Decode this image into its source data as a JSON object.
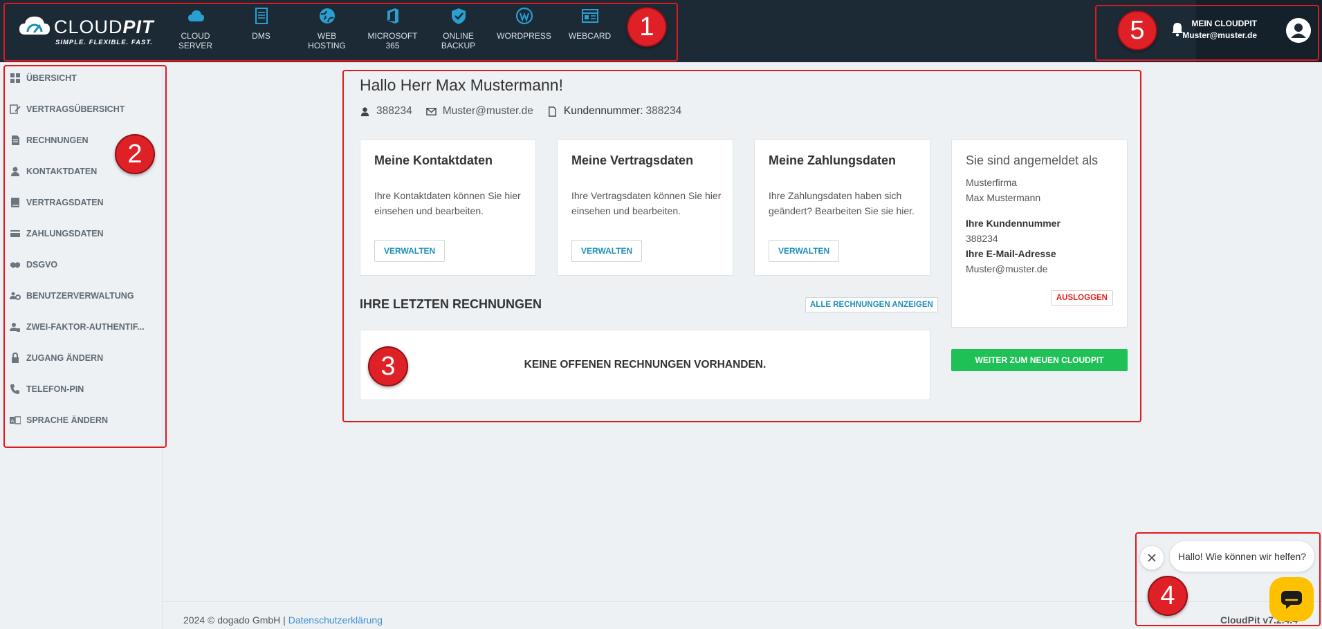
{
  "header": {
    "logo": {
      "brand_thin": "CLOUD",
      "brand_bold": "PIT",
      "tagline": "SIMPLE. FLEXIBLE. FAST."
    },
    "nav": [
      {
        "label": "CLOUD\nSERVER",
        "icon": "cloud-icon"
      },
      {
        "label": "DMS",
        "icon": "document-icon"
      },
      {
        "label": "WEB\nHOSTING",
        "icon": "globe-icon"
      },
      {
        "label": "MICROSOFT 365",
        "icon": "office-icon"
      },
      {
        "label": "ONLINE\nBACKUP",
        "icon": "shield-icon"
      },
      {
        "label": "WORDPRESS",
        "icon": "wordpress-icon"
      },
      {
        "label": "WEBCARD",
        "icon": "webcard-icon"
      }
    ],
    "account": {
      "title": "MEIN CLOUDPIT",
      "email": "Muster@muster.de"
    }
  },
  "markers": [
    "1",
    "2",
    "3",
    "4",
    "5"
  ],
  "sidebar": {
    "items": [
      {
        "label": "ÜBERSICHT",
        "icon": "grid-icon"
      },
      {
        "label": "VERTRAGSÜBERSICHT",
        "icon": "contract-edit-icon"
      },
      {
        "label": "RECHNUNGEN",
        "icon": "invoice-icon"
      },
      {
        "label": "KONTAKTDATEN",
        "icon": "user-icon"
      },
      {
        "label": "VERTRAGSDATEN",
        "icon": "book-icon"
      },
      {
        "label": "ZAHLUNGSDATEN",
        "icon": "credit-card-icon"
      },
      {
        "label": "DSGVO",
        "icon": "handshake-icon"
      },
      {
        "label": "BENUTZERVERWALTUNG",
        "icon": "users-cog-icon"
      },
      {
        "label": "ZWEI-FAKTOR-AUTHENTIF...",
        "icon": "user-lock-icon"
      },
      {
        "label": "ZUGANG ÄNDERN",
        "icon": "lock-icon"
      },
      {
        "label": "TELEFON-PIN",
        "icon": "phone-icon"
      },
      {
        "label": "SPRACHE ÄNDERN",
        "icon": "language-icon"
      }
    ]
  },
  "main": {
    "greeting": "Hallo Herr Max Mustermann!",
    "meta": {
      "user_id": "388234",
      "email": "Muster@muster.de",
      "customer_label": "Kundennummer:",
      "customer_number": "388234"
    },
    "cards": [
      {
        "title": "Meine Kontaktdaten",
        "text": "Ihre Kontaktdaten können Sie hier einsehen und bearbeiten.",
        "button": "VERWALTEN"
      },
      {
        "title": "Meine Vertragsdaten",
        "text": "Ihre Vertragsdaten können Sie hier einsehen und bearbeiten.",
        "button": "VERWALTEN"
      },
      {
        "title": "Meine Zahlungsdaten",
        "text": "Ihre Zahlungsdaten haben sich geändert? Bearbeiten Sie sie hier.",
        "button": "VERWALTEN"
      }
    ],
    "login": {
      "title": "Sie sind angemeldet als",
      "company": "Musterfirma",
      "name": "Max Mustermann",
      "customer_label": "Ihre Kundennummer",
      "customer_number": "388234",
      "email_label": "Ihre E-Mail-Adresse",
      "email": "Muster@muster.de",
      "logout": "AUSLOGGEN"
    },
    "invoices": {
      "title": "IHRE LETZTEN RECHNUNGEN",
      "all_link": "ALLE RECHNUNGEN ANZEIGEN",
      "empty": "KEINE OFFENEN RECHNUNGEN VORHANDEN."
    },
    "new_cloudpit_button": "WEITER ZUM NEUEN CLOUDPIT"
  },
  "footer": {
    "copyright": "2024 © dogado GmbH | ",
    "privacy_link": "Datenschutzerklärung",
    "version": "CloudPit v7.2.4.4"
  },
  "chat": {
    "bubble": "Hallo! Wie können wir helfen?"
  },
  "colors": {
    "header_bg": "#1c2a36",
    "accent_blue": "#1c8fb8",
    "green": "#1fc156",
    "marker_red": "#e02027",
    "chat_yellow": "#fec100"
  }
}
